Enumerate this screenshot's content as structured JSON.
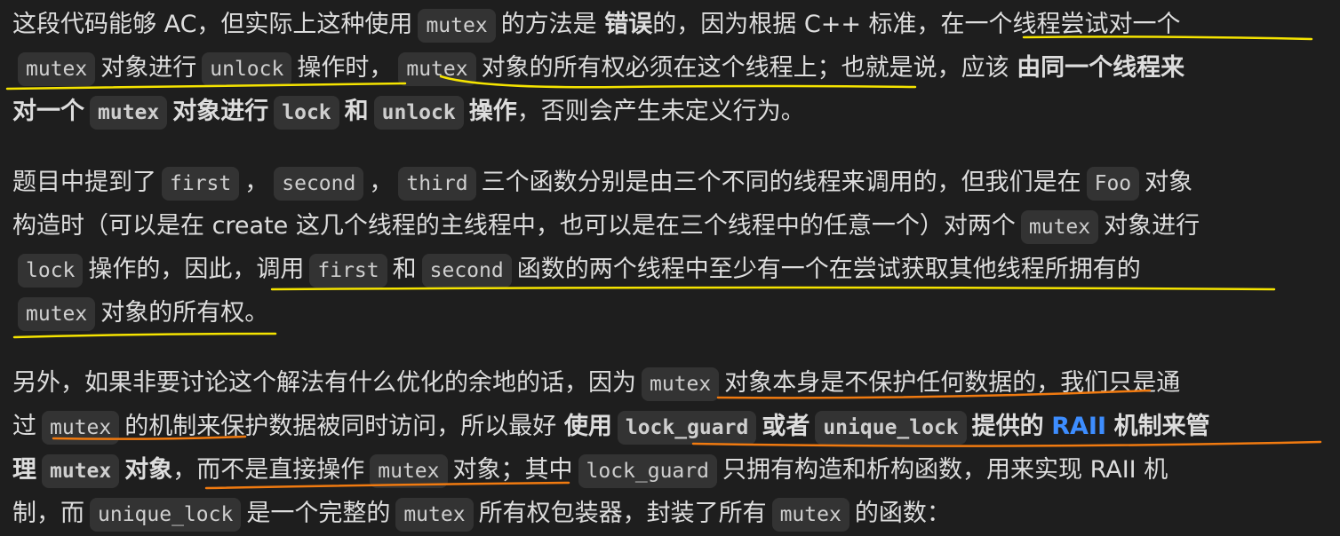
{
  "p1": {
    "l1": {
      "a": "这段代码能够 AC，但实际上这种使用",
      "code_mutex": "mutex",
      "b": "的方法是",
      "bold_wrong": "错误",
      "c": "的，因为根据 C++ 标准，",
      "d": "在一个线程尝试对一个"
    },
    "l2": {
      "code_mutex": "mutex",
      "a": "对象进行",
      "code_unlock": "unlock",
      "b": "操作时，",
      "code_mutex2": "mutex",
      "c": "对象的所有权必须在这个线程上；",
      "d": "也就是说，应该",
      "bold": "由同一个线程来"
    },
    "l3": {
      "bold_a": "对一个",
      "code_mutex": "mutex",
      "bold_b": "对象进行",
      "code_lock": "lock",
      "bold_c": "和",
      "code_unlock": "unlock",
      "bold_d": "操作",
      "e": "，否则会产生未定义行为。"
    }
  },
  "p2": {
    "l1": {
      "a": "题目中提到了",
      "code_first": "first",
      "comma1": "，",
      "code_second": "second",
      "comma2": "，",
      "code_third": "third",
      "b": "三个函数分别是由三个不同的线程来调用的，但我们是在",
      "code_foo": "Foo",
      "c": "对象"
    },
    "l2": {
      "a": "构造时（可以是在 create 这几个线程的主线程中，也可以是在三个线程中的任意一个）对两个",
      "code_mutex": "mutex",
      "b": "对象进行"
    },
    "l3": {
      "code_lock": "lock",
      "a": "操作的，因此，",
      "b": "调用",
      "code_first": "first",
      "c": "和",
      "code_second": "second",
      "d": "函数的两个线程中至少有一个在尝试获取其他线程所拥有的"
    },
    "l4": {
      "code_mutex": "mutex",
      "a": "对象的所有权。"
    }
  },
  "p3": {
    "l1": {
      "a": "另外，如果非要讨论这个解法有什么优化的余地的话，因为",
      "code_mutex": "mutex",
      "b": "对象本身是不保护任何数据的",
      "c": "，我们只是通"
    },
    "l2": {
      "a": "过",
      "code_mutex": "mutex",
      "b": "的机制来",
      "c": "保护数据被同时访问，所以最好",
      "bold_use": "使用",
      "code_lock_guard": "lock_guard",
      "bold_or": "或者",
      "code_unique_lock": "unique_lock",
      "bold_provided": "提供的",
      "raii": "RAII",
      "bold_mech": "机制来管"
    },
    "l3": {
      "bold_a": "理",
      "code_mutex": "mutex",
      "bold_b": "对象",
      "c": "，",
      "d": "而不是直接操作",
      "code_mutex2": "mutex",
      "e": "对象",
      "f": "；其中",
      "code_lock_guard": "lock_guard",
      "g": "只拥有构造和析构函数，用来实现 RAII 机"
    },
    "l4": {
      "a": "制，而",
      "code_unique_lock": "unique_lock",
      "b": "是一个完整的",
      "code_mutex": "mutex",
      "c": "所有权包装器，封装了所有",
      "code_mutex2": "mutex",
      "d": "的函数："
    }
  },
  "colors": {
    "background": "#1e1e1e",
    "text": "#dddddd",
    "code_bg": "#333333",
    "accent_blue": "#3d8dff",
    "underline_yellow": "#f5e400",
    "underline_orange": "#f07a10"
  }
}
